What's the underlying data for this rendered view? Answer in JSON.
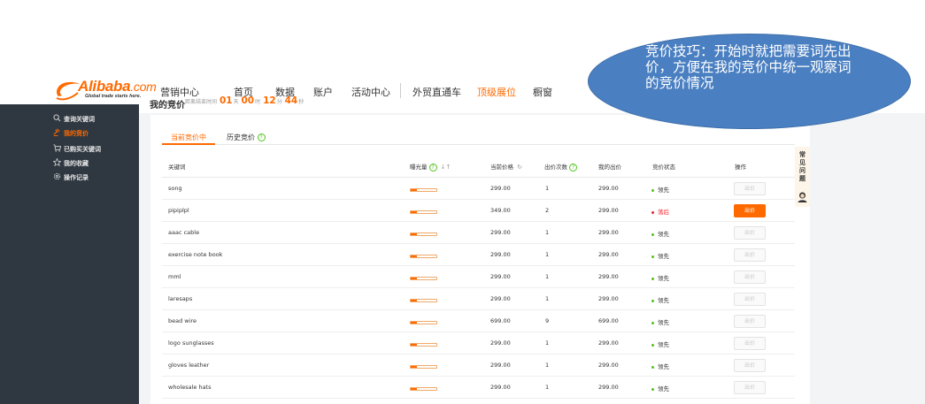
{
  "logo": {
    "brand": "Alibaba",
    "suffix": ".com",
    "tagline": "Global trade starts here.",
    "color": "#ff6a00"
  },
  "nav": {
    "section": "营销中心",
    "items": [
      "首页",
      "数据",
      "账户",
      "活动中心",
      "外贸直通车",
      "顶级展位",
      "橱窗"
    ],
    "active": "顶级展位"
  },
  "callout": {
    "text": "竞价技巧：开始时就把需要词先出价，方便在我的竞价中统一观察词的竞价情况",
    "color": "#4a7fc1"
  },
  "sidebar": {
    "items": [
      {
        "label": "查询关键词",
        "icon": "search-icon",
        "active": false
      },
      {
        "label": "我的竞价",
        "icon": "bid-icon",
        "active": true
      },
      {
        "label": "已购买关键词",
        "icon": "cart-icon",
        "active": false
      },
      {
        "label": "我的收藏",
        "icon": "star-icon",
        "active": false
      },
      {
        "label": "操作记录",
        "icon": "gear-icon",
        "active": false
      }
    ]
  },
  "page": {
    "title": "我的竞价",
    "countdown": {
      "prefix": "距离结束时间",
      "days": "01",
      "days_unit": "天",
      "hours": "00",
      "hours_unit": "时",
      "minutes": "12",
      "minutes_unit": "分",
      "seconds": "44",
      "seconds_unit": "秒"
    }
  },
  "tabs": [
    {
      "label": "当前竞价中",
      "active": true
    },
    {
      "label": "历史竞价",
      "active": false
    }
  ],
  "table": {
    "headers": {
      "keyword": "关键词",
      "exposure": "曝光量",
      "current_price": "当前价格",
      "bid_count": "出价次数",
      "my_bid": "我的出价",
      "status": "竞价状态",
      "action": "操作"
    },
    "rows": [
      {
        "keyword": "song",
        "exposure": 0.25,
        "current_price": "299.00",
        "bid_count": "1",
        "my_bid": "299.00",
        "status": "领先",
        "status_type": "lead",
        "action": "出价"
      },
      {
        "keyword": "pipiplpl",
        "exposure": 0.25,
        "current_price": "349.00",
        "bid_count": "2",
        "my_bid": "299.00",
        "status": "落后",
        "status_type": "behind",
        "action": "出价"
      },
      {
        "keyword": "aaac cable",
        "exposure": 0.25,
        "current_price": "299.00",
        "bid_count": "1",
        "my_bid": "299.00",
        "status": "领先",
        "status_type": "lead",
        "action": "出价"
      },
      {
        "keyword": "exercise note book",
        "exposure": 0.25,
        "current_price": "299.00",
        "bid_count": "1",
        "my_bid": "299.00",
        "status": "领先",
        "status_type": "lead",
        "action": "出价"
      },
      {
        "keyword": "mml",
        "exposure": 0.25,
        "current_price": "299.00",
        "bid_count": "1",
        "my_bid": "299.00",
        "status": "领先",
        "status_type": "lead",
        "action": "出价"
      },
      {
        "keyword": "laresaps",
        "exposure": 0.25,
        "current_price": "299.00",
        "bid_count": "1",
        "my_bid": "299.00",
        "status": "领先",
        "status_type": "lead",
        "action": "出价"
      },
      {
        "keyword": "bead wire",
        "exposure": 0.25,
        "current_price": "699.00",
        "bid_count": "9",
        "my_bid": "699.00",
        "status": "领先",
        "status_type": "lead",
        "action": "出价"
      },
      {
        "keyword": "logo sunglasses",
        "exposure": 0.25,
        "current_price": "299.00",
        "bid_count": "1",
        "my_bid": "299.00",
        "status": "领先",
        "status_type": "lead",
        "action": "出价"
      },
      {
        "keyword": "gloves leather",
        "exposure": 0.25,
        "current_price": "299.00",
        "bid_count": "1",
        "my_bid": "299.00",
        "status": "领先",
        "status_type": "lead",
        "action": "出价"
      },
      {
        "keyword": "wholesale hats",
        "exposure": 0.25,
        "current_price": "299.00",
        "bid_count": "1",
        "my_bid": "299.00",
        "status": "领先",
        "status_type": "lead",
        "action": "出价"
      }
    ]
  },
  "faq": {
    "label": "常见问题"
  },
  "colors": {
    "accent": "#ff6a00",
    "lead": "#52c41a",
    "behind": "#f5222d",
    "sidebar": "#2f3841"
  }
}
